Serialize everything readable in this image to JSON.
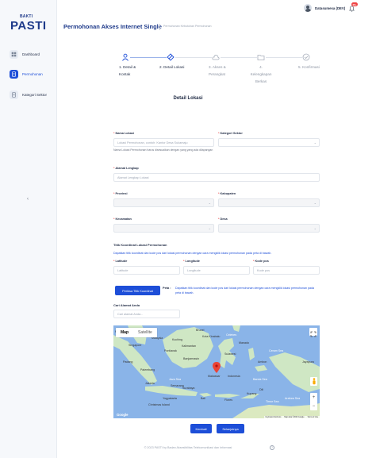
{
  "app": {
    "logo_top": "BAKTI",
    "logo_main": "PASTI"
  },
  "sidebar": {
    "items": [
      {
        "label": "Dashboard",
        "icon": "dashboard-icon",
        "active": false
      },
      {
        "label": "Permohonan",
        "icon": "file-icon",
        "active": true
      },
      {
        "label": "Kategori Sektor",
        "icon": "list-icon",
        "active": false
      }
    ],
    "collapse_glyph": "‹"
  },
  "header": {
    "title": "Permohonan Akses Internet Single",
    "breadcrumb": "Permohonan Kebutuhan Permohonan",
    "user_name": "Datasumesa (DEV)",
    "notif_count": "99+"
  },
  "stepper": {
    "steps": [
      {
        "label_line1": "1. Detail &",
        "label_line2": "Kontak",
        "icon": "user-icon",
        "state": "done"
      },
      {
        "label_line1": "2. Detail Lokasi",
        "label_line2": "",
        "icon": "location-icon",
        "state": "active"
      },
      {
        "label_line1": "3. Akses &",
        "label_line2": "Perangkat",
        "icon": "cloud-icon",
        "state": "todo"
      },
      {
        "label_line1": "4. Kelengkapan",
        "label_line2": "Berkas",
        "icon": "folder-icon",
        "state": "todo"
      },
      {
        "label_line1": "5. Konfirmasi",
        "label_line2": "",
        "icon": "check-circle-icon",
        "state": "todo"
      }
    ]
  },
  "form": {
    "section_title": "Detail Lokasi",
    "required_mark": "*",
    "nama_lokasi": {
      "label": "Nama Lokasi",
      "placeholder": "Lokasi Permohonan, contoh: Kantor Desa Sukamaju",
      "hint": "Nama Lokasi Permohonan harus disesuaikan dengan yang yang ada dilapangan"
    },
    "kategori_sektor": {
      "label": "Kategori Sektor"
    },
    "alamat": {
      "label": "Alamat Lengkap",
      "placeholder": "Alamat Lengkap Lokasi"
    },
    "provinsi": {
      "label": "Provinsi"
    },
    "kabupaten": {
      "label": "Kabupaten"
    },
    "kecamatan": {
      "label": "Kecamatan"
    },
    "desa": {
      "label": "Desa"
    },
    "koordinat": {
      "title": "Titik Koordinat Lokasi Permohonan",
      "hint": "Dapatkan titik koordinat dan kode pos dari lokasi permohonan dengan cara mengklik lokasi permohonan pada peta di bawah."
    },
    "latitude": {
      "label": "Latitude",
      "placeholder": "Latitude"
    },
    "longitude": {
      "label": "Longitude",
      "placeholder": "Longitude"
    },
    "kode_pos": {
      "label": "Kode pos",
      "placeholder": "Kode pos"
    },
    "check_button": "Periksa Titik Koordinat",
    "peta_label": "Peta :",
    "peta_text": "Dapatkan titik koordinat dan kode pos dari lokasi permohonan dengan cara mengklik lokasi permohonan pada peta di bawah.",
    "cari_alamat": {
      "label": "Cari Alamat Anda",
      "placeholder": "Cari alamat Anda..."
    }
  },
  "map": {
    "tab_map": "Map",
    "tab_satellite": "Satellite",
    "labels": [
      "Singapore",
      "Indonesia",
      "Jakarta",
      "Banjarmasin",
      "Makassar",
      "Java Sea",
      "Banda Sea",
      "Timor Sea",
      "Surabaya",
      "Sulawesi",
      "Celebes",
      "Malaysia",
      "Brunei",
      "Kupang",
      "Dili",
      "Ambon",
      "Jayapura",
      "Christmas Island",
      "Yogyakarta",
      "Semarang",
      "Bali",
      "Flores",
      "Kalimantan",
      "Arafura Sea",
      "Ceram Sea",
      "Pontianak",
      "Kuching",
      "Kota Kinabalu",
      "Manado",
      "Medan",
      "Padang",
      "Palembang"
    ],
    "zoom_in": "+",
    "zoom_out": "−",
    "google": "Google",
    "attrib_1": "Keyboard shortcuts",
    "attrib_2": "Map data ©2023 Google",
    "attrib_3": "Terms of Use"
  },
  "actions": {
    "back": "Kembali",
    "next": "Selanjutnya"
  },
  "footer": {
    "text": "© 2023 PASTI by Badan Aksesibilitas Telekomunikasi dan Informasi",
    "help": "?"
  },
  "colors": {
    "primary": "#1d4ed8",
    "brand": "#1e3a8a",
    "required": "#ef4444",
    "map_water": "#8ab4e8",
    "map_land": "#cfe7c4"
  }
}
